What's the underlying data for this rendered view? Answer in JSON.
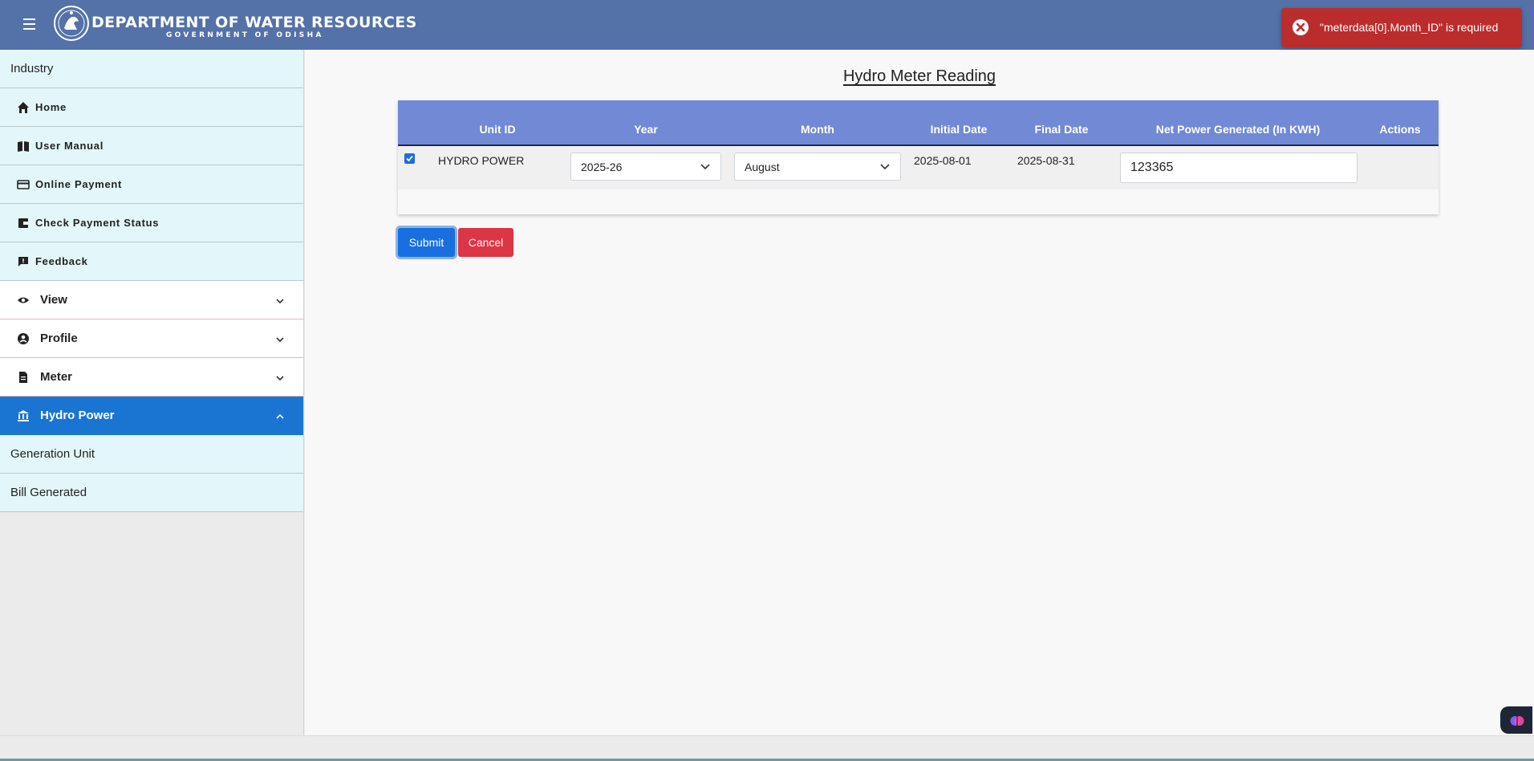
{
  "header": {
    "title": "DEPARTMENT OF WATER RESOURCES",
    "subtitle": "GOVERNMENT OF ODISHA",
    "icons": [
      "hamburger-menu-icon",
      "odisha-emblem-logo"
    ],
    "color": "#5471a8"
  },
  "toast": {
    "message": "\"meterdata[0].Month_ID\" is required",
    "icon": "error-x-icon",
    "color": "#bb2d2d"
  },
  "sidebar": {
    "section_title": "Industry",
    "links": [
      {
        "label": "Home",
        "icon": "home-icon"
      },
      {
        "label": "User Manual",
        "icon": "book-icon"
      },
      {
        "label": "Online Payment",
        "icon": "credit-card-icon"
      },
      {
        "label": "Check Payment Status",
        "icon": "wallet-icon"
      },
      {
        "label": "Feedback",
        "icon": "feedback-icon"
      }
    ],
    "groups": [
      {
        "label": "View",
        "icon": "eye-icon",
        "expanded": false
      },
      {
        "label": "Profile",
        "icon": "user-circle-icon",
        "expanded": false
      },
      {
        "label": "Meter",
        "icon": "document-icon",
        "expanded": false
      },
      {
        "label": "Hydro Power",
        "icon": "bank-icon",
        "expanded": true,
        "active": true
      }
    ],
    "sub_items": [
      {
        "label": "Generation Unit"
      },
      {
        "label": "Bill Generated"
      }
    ],
    "active_color": "#1a75d2"
  },
  "main": {
    "title": "Hydro Meter Reading",
    "table": {
      "headers": [
        "Unit ID",
        "Year",
        "Month",
        "Initial Date",
        "Final Date",
        "Net Power Generated (In KWH)",
        "Actions"
      ],
      "header_color": "#7289d6",
      "rows": [
        {
          "checked": true,
          "unit_id": "HYDRO POWER",
          "year": "2025-26",
          "month": "August",
          "initial_date": "2025-08-01",
          "final_date": "2025-08-31",
          "net_power": "123365"
        }
      ]
    },
    "buttons": {
      "submit": "Submit",
      "cancel": "Cancel"
    }
  },
  "colors": {
    "submit": "#1a6fe0",
    "cancel": "#dc3545"
  }
}
